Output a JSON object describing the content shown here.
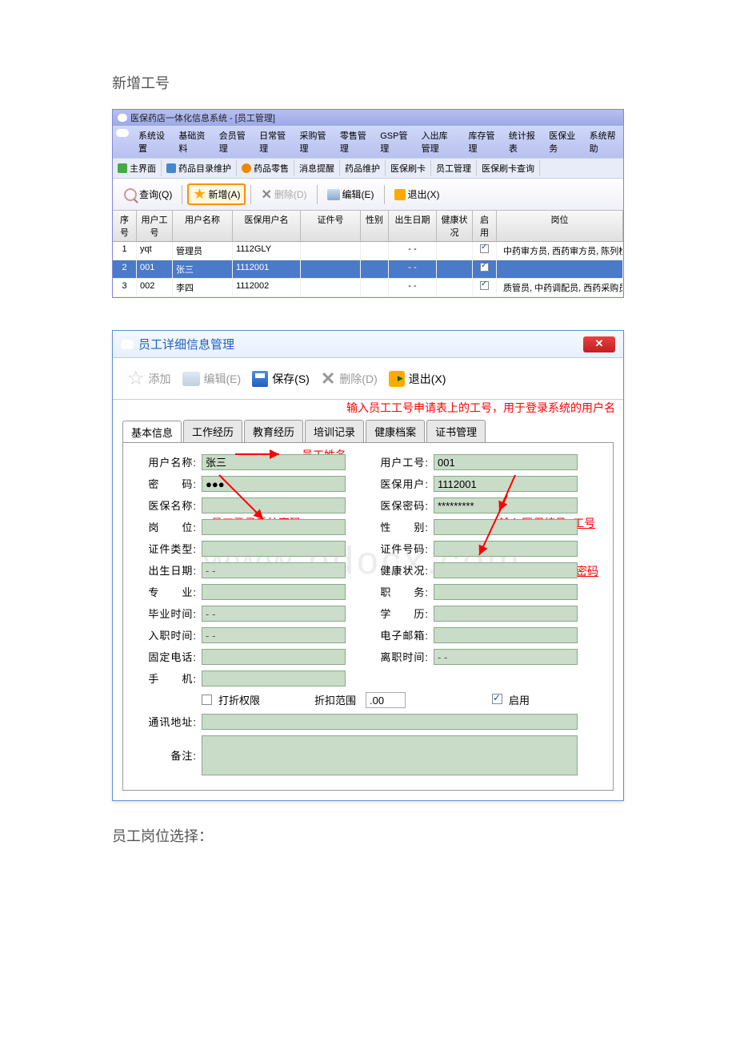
{
  "doc": {
    "heading1": "新增工号",
    "heading2": "员工岗位选择："
  },
  "win1": {
    "title": "医保药店一体化信息系统 - [员工管理]",
    "menu": [
      "系统设置",
      "基础资料",
      "会员管理",
      "日常管理",
      "采购管理",
      "零售管理",
      "GSP管理",
      "入出库管理",
      "库存管理",
      "统计报表",
      "医保业务",
      "系统帮助"
    ],
    "subtabs": {
      "main": "主界面",
      "drug_dir": "药品目录维护",
      "drug_retail": "药品零售",
      "msg": "消息提醒",
      "drug_maint": "药品维护",
      "yb_card": "医保刷卡",
      "emp_mgmt": "员工管理",
      "yb_query": "医保刷卡查询"
    },
    "tb": {
      "query": "查询(Q)",
      "add": "新增(A)",
      "del": "删除(D)",
      "edit": "编辑(E)",
      "exit": "退出(X)"
    },
    "cols": {
      "seq": "序号",
      "uid": "用户工号",
      "uname": "用户名称",
      "yb": "医保用户名",
      "cert": "证件号",
      "sex": "性别",
      "birth": "出生日期",
      "health": "健康状况",
      "enable": "启用",
      "role": "岗位"
    },
    "rows": [
      {
        "seq": "1",
        "uid": "yqt",
        "uname": "管理员",
        "yb": "1112GLY",
        "cert": "",
        "sex": "",
        "birth": "-  -",
        "health": "",
        "enable": true,
        "role": "中药审方员, 西药审方员, 陈列检查员, 系统管理员, 企业负责人, 中药"
      },
      {
        "seq": "2",
        "uid": "001",
        "uname": "张三",
        "yb": "1112001",
        "cert": "",
        "sex": "",
        "birth": "-  -",
        "health": "",
        "enable": true,
        "role": ""
      },
      {
        "seq": "3",
        "uid": "002",
        "uname": "李四",
        "yb": "1112002",
        "cert": "",
        "sex": "",
        "birth": "-  -",
        "health": "",
        "enable": true,
        "role": "质管员, 中药调配员, 西药采购员, 收银员, 中药验收员, 西药调配员,"
      }
    ]
  },
  "win2": {
    "title": "员工详细信息管理",
    "tb": {
      "add": "添加",
      "edit": "编辑(E)",
      "save": "保存(S)",
      "del": "删除(D)",
      "exit": "退出(X)"
    },
    "tabs": [
      "基本信息",
      "工作经历",
      "教育经历",
      "培训记录",
      "健康档案",
      "证书管理"
    ],
    "form": {
      "uname_lbl": "用户名称:",
      "uname": "张三",
      "uid_lbl": "用户工号:",
      "uid": "001",
      "pwd_lbl": "密　　码:",
      "pwd": "●●●",
      "ybu_lbl": "医保用户:",
      "ybu": "1112001",
      "ybn_lbl": "医保名称:",
      "ybn": "",
      "ybp_lbl": "医保密码:",
      "ybp": "*********",
      "pos_lbl": "岗　　位:",
      "pos": "",
      "sex_lbl": "性　　别:",
      "sex": "",
      "cert_type_lbl": "证件类型:",
      "cert_type": "",
      "cert_no_lbl": "证件号码:",
      "cert_no": "",
      "birth_lbl": "出生日期:",
      "birth": "  -   -",
      "health_lbl": "健康状况:",
      "health": "",
      "major_lbl": "专　　业:",
      "major": "",
      "duty_lbl": "职　　务:",
      "duty": "",
      "grad_lbl": "毕业时间:",
      "grad": "  -   -",
      "edu_lbl": "学　　历:",
      "edu": "",
      "join_lbl": "入职时间:",
      "join": "  -   -",
      "email_lbl": "电子邮箱:",
      "email": "",
      "tel_lbl": "固定电话:",
      "tel": "",
      "leave_lbl": "离职时间:",
      "leave": "  -   -",
      "mobile_lbl": "手　　机:",
      "mobile": "",
      "discount_perm": "打折权限",
      "discount_range_lbl": "折扣范围",
      "discount_range": ".00",
      "enable_lbl": "启用",
      "addr_lbl": "通讯地址:",
      "addr": "",
      "remark_lbl": "备注:",
      "remark": ""
    },
    "anno": {
      "name": "员工姓名",
      "pwd": "员工登录系统密码",
      "uid": "输入员工工号申请表上的工号，用于登录系统的用户名",
      "ybu": "输入医保编号+工号",
      "ybp": "输入工号申请表上的密码"
    }
  },
  "watermark": "www.bdocx.com"
}
